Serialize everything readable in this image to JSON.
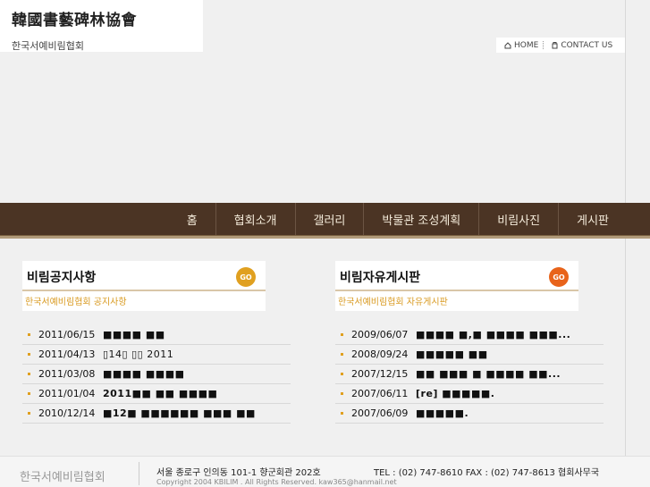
{
  "header": {
    "logo_hanja": "韓國書藝碑林協會",
    "logo_korean": "한국서예비림협회",
    "home_label": "HOME",
    "contact_label": "CONTACT US"
  },
  "nav": {
    "items": [
      "홈",
      "협회소개",
      "갤러리",
      "박물관 조성계획",
      "비림사진",
      "게시판"
    ]
  },
  "notice": {
    "title": "비림공지사항",
    "subtitle": "한국서예비림협회 공지사항",
    "go_label": "GO",
    "rows": [
      {
        "date": "2011/06/15",
        "title": "■■■■ ■■"
      },
      {
        "date": "2011/04/13",
        "title": "▯14▯ ▯▯ 2011"
      },
      {
        "date": "2011/03/08",
        "title": "■■■■ ■■■■"
      },
      {
        "date": "2011/01/04",
        "title": "2011■■ ■■ ■■■■"
      },
      {
        "date": "2010/12/14",
        "title": "■12■ ■■■■■■ ■■■ ■■"
      }
    ]
  },
  "board": {
    "title": "비림자유게시판",
    "subtitle": "한국서예비림협회 자유게시판",
    "go_label": "GO",
    "rows": [
      {
        "date": "2009/06/07",
        "title": "■■■■ ■,■ ■■■■ ■■■..."
      },
      {
        "date": "2008/09/24",
        "title": "■■■■■ ■■"
      },
      {
        "date": "2007/12/15",
        "title": "■■ ■■■ ■ ■■■■ ■■..."
      },
      {
        "date": "2007/06/11",
        "title": "[re] ■■■■■."
      },
      {
        "date": "2007/06/09",
        "title": "■■■■■."
      }
    ]
  },
  "footer": {
    "brand": "한국서예비림협회",
    "address": "서울 종로구 인의동 101-1 향군회관 202호",
    "tel": "TEL : (02) 747-8610    FAX : (02) 747-8613  협회사무국",
    "copyright": "Copyright  2004   KBILIM .  All Rights Reserved.      kaw365@hanmail.net"
  },
  "colors": {
    "nav_bg": "#4b3424",
    "accent": "#e0a020",
    "accent_orange": "#e8631a"
  }
}
